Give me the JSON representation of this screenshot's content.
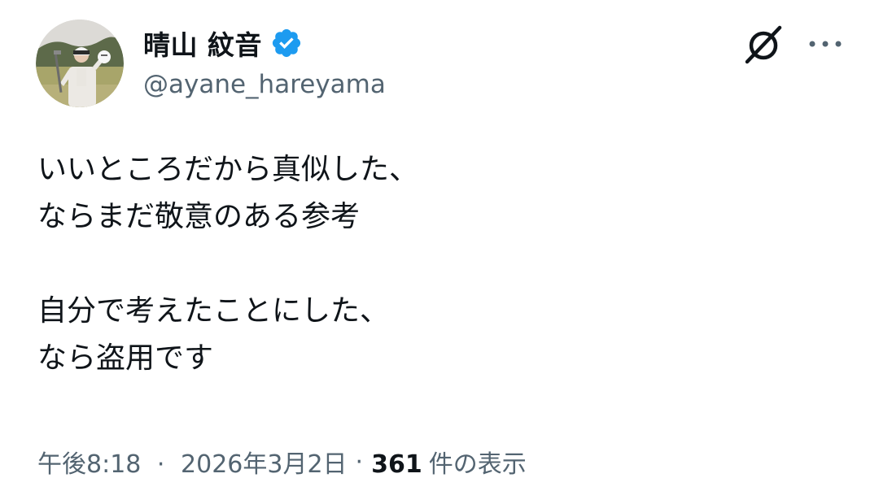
{
  "author": {
    "display_name": "晴山 紋音",
    "handle": "@ayane_hareyama",
    "verified": true,
    "verified_color": "#1d9bf0",
    "avatar_icon": "profile-photo"
  },
  "actions": {
    "grok_icon": "grok-icon",
    "more_icon": "more-horizontal-icon"
  },
  "tweet": {
    "lines": [
      "いいところだから真似した、",
      "ならまだ敬意のある参考",
      "",
      "自分で考えたことにした、",
      "なら盗用です"
    ]
  },
  "meta": {
    "time": "午後8:18",
    "separator": "·",
    "date": "2026年3月2日",
    "views_count": "361",
    "views_label": "件の表示"
  },
  "colors": {
    "text_primary": "#0f1419",
    "text_secondary": "#536471",
    "background": "#ffffff"
  }
}
